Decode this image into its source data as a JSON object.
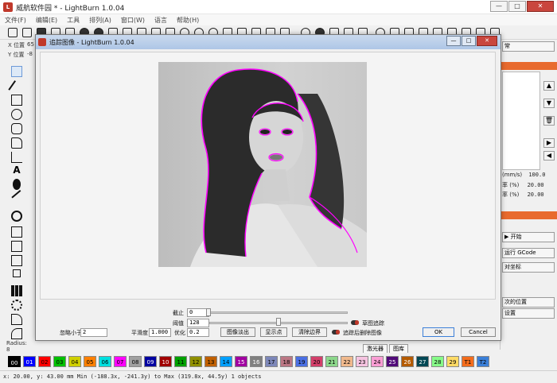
{
  "window": {
    "title": "威航软件园 * - LightBurn 1.0.04",
    "min": "—",
    "max": "□",
    "close": "✕"
  },
  "menu": [
    "文件(F)",
    "编辑(E)",
    "工具",
    "排列(A)",
    "窗口(W)",
    "语言",
    "帮助(H)"
  ],
  "position": {
    "x_label": "X 位置",
    "x_value": "65",
    "y_label": "Y 位置",
    "y_value": "-8"
  },
  "left_tools": {
    "radius_label": "Radius:",
    "radius_value": "8"
  },
  "right_panel": {
    "dropdown": "常",
    "rows": [
      {
        "label": "(mm/s)",
        "value": "100.0"
      },
      {
        "label": "率 (%)",
        "value": "20.00"
      },
      {
        "label": "率 (%)",
        "value": "20.00"
      }
    ],
    "start_button": "开始",
    "gcode_button": "运行 GCode",
    "coord_select": "对坐标",
    "saved_pos_button": "次的位置",
    "settings_button": "设置"
  },
  "dialog": {
    "title": "追踪图像 - LightBurn 1.0.04",
    "cutoff": {
      "label": "截止",
      "value": "0"
    },
    "threshold": {
      "label": "阈值",
      "value": "128"
    },
    "ignore_less": {
      "label": "忽略小于",
      "value": "2"
    },
    "smoothness": {
      "label": "平滑度",
      "value": "1.000"
    },
    "optimize": {
      "label": "优化",
      "value": "0.2"
    },
    "fade_button": "图像淡出",
    "show_points_button": "显示点",
    "clear_bounds_button": "清除边界",
    "sketch_trace_label": "草图追踪",
    "delete_after_label": "追踪后删除图像",
    "ok_button": "OK",
    "cancel_button": "Cancel"
  },
  "bottom_tabs": [
    "激光器",
    "图库"
  ],
  "palette": [
    "00",
    "01",
    "02",
    "03",
    "04",
    "05",
    "06",
    "07",
    "08",
    "09",
    "10",
    "11",
    "12",
    "13",
    "14",
    "15",
    "16",
    "17",
    "18",
    "19",
    "20",
    "21",
    "22",
    "23",
    "24",
    "25",
    "26",
    "27",
    "28",
    "29",
    "T1",
    "T2"
  ],
  "palette_colors": [
    "#000000",
    "#0000ff",
    "#ff0000",
    "#00c000",
    "#d0d000",
    "#ff8000",
    "#00e0e0",
    "#ff00ff",
    "#a0a0a0",
    "#0000a0",
    "#a00000",
    "#00a000",
    "#909000",
    "#c06000",
    "#00a0ff",
    "#a000a0",
    "#808080",
    "#7d87b9",
    "#bb7784",
    "#4a6fe3",
    "#d33f6a",
    "#8cd78b",
    "#f0b98d",
    "#f6c4e1",
    "#fa9ed4",
    "#500a78",
    "#b45a00",
    "#004754",
    "#86fa88",
    "#ffdb66",
    "#f36c1c",
    "#3a7fd8"
  ],
  "status": {
    "text": "x: 20.00, y: 43.00 mm    Min (-188.3x, -241.3y) to Max (319.8x, 44.5y)  1 objects"
  }
}
